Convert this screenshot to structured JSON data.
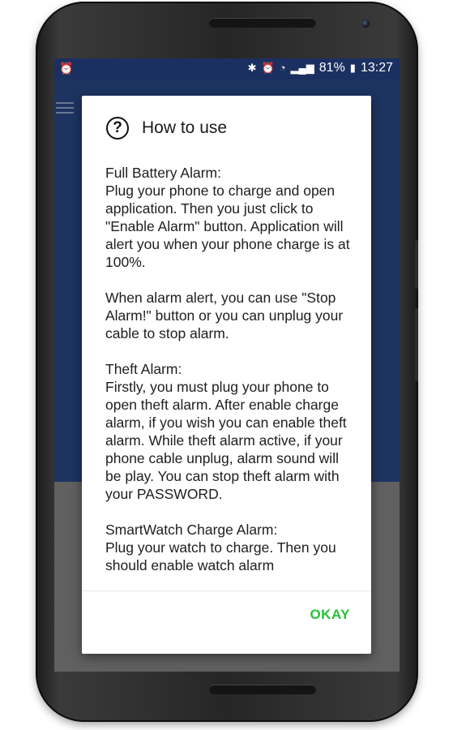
{
  "status_bar": {
    "left_icon": "alarm-clock-icon",
    "icons": [
      "bluetooth-icon",
      "alarm-clock-icon",
      "wifi-icon",
      "signal-icon",
      "battery-icon"
    ],
    "battery": "81%",
    "time": "13:27"
  },
  "dialog": {
    "icon": "help-icon",
    "title": "How to use",
    "paragraphs": [
      "Full Battery Alarm:\nPlug your phone to charge and open application. Then you just click to \"Enable Alarm\" button. Application will alert you when your phone charge is at 100%.",
      "When alarm alert, you can use \"Stop Alarm!\" button or you can unplug your cable to stop alarm.",
      "Theft Alarm:\nFirstly, you must plug your phone to open theft alarm. After enable charge alarm, if you wish you can enable theft alarm. While theft alarm active, if your phone cable unplug, alarm sound will be play. You can stop theft alarm with your PASSWORD.",
      "SmartWatch Charge Alarm:\nPlug your watch to charge. Then you should enable watch alarm"
    ],
    "okay_label": "OKAY"
  },
  "colors": {
    "app_header": "#1d3461",
    "status_bar": "#1b3060",
    "app_bottom": "#606060",
    "accent": "#27c236"
  }
}
